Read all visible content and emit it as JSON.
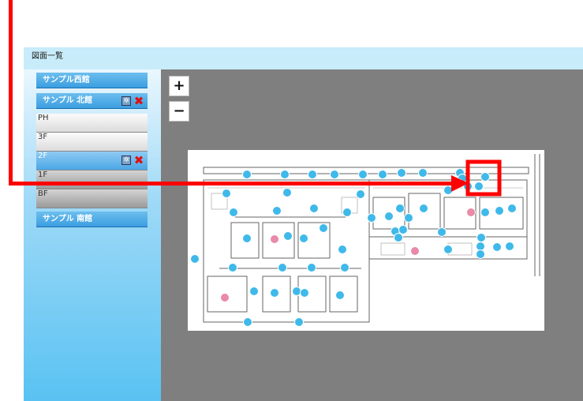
{
  "header": {
    "title": "図面一覧"
  },
  "buildings": [
    {
      "name": "サンプル西館"
    },
    {
      "name": "サンプル 北館"
    },
    {
      "name": "サンプル 南館"
    }
  ],
  "floors": [
    {
      "label": "PH"
    },
    {
      "label": "3F"
    },
    {
      "label": "2F"
    },
    {
      "label": "1F"
    },
    {
      "label": "BF"
    }
  ],
  "map": {
    "zoom_in": "+",
    "zoom_out": "−"
  },
  "icons": {
    "settings": "gear-icon",
    "delete": "delete-x-icon"
  },
  "colors": {
    "marker_blue": "#3fb9ea",
    "marker_pink": "#ea8aa8",
    "annotation_red": "#ff0000"
  }
}
